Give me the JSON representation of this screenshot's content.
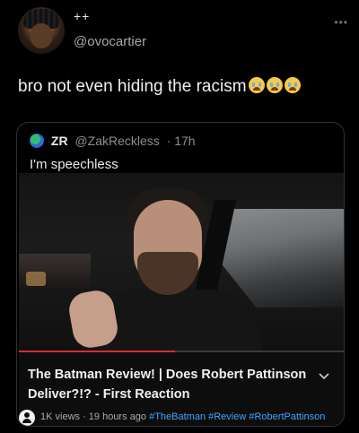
{
  "tweet": {
    "display_name": "++",
    "handle": "@ovocartier",
    "more_icon": "more-dots-icon",
    "text": "bro not even hiding the racism",
    "emojis": [
      "loudly-crying-face",
      "loudly-crying-face",
      "loudly-crying-face"
    ]
  },
  "quoted_tweet": {
    "name": "ZR",
    "handle": "@ZakReckless",
    "time": "· 17h",
    "text": "I'm speechless"
  },
  "video": {
    "title": "The Batman Review! | Does Robert Pattinson Deliver?!? - First Reaction",
    "progress_fraction": 0.48,
    "meta": "1K views · 19 hours ago",
    "hashtags": [
      "#TheBatman",
      "#Review",
      "#RobertPattinson"
    ],
    "colors": {
      "progress": "#d32f2f",
      "hashtag": "#3ea6ff"
    }
  }
}
